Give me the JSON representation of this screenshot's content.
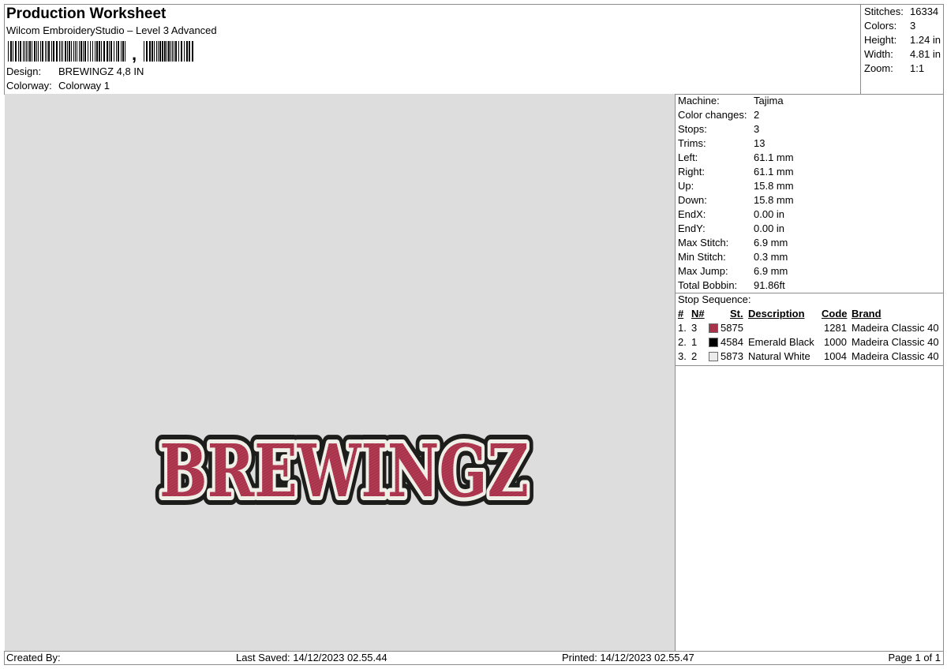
{
  "header": {
    "title": "Production Worksheet",
    "subtitle": "Wilcom EmbroideryStudio – Level 3 Advanced",
    "barcode_text": ",",
    "design_label": "Design:",
    "design_value": "BREWINGZ 4,8 IN",
    "colorway_label": "Colorway:",
    "colorway_value": "Colorway 1"
  },
  "stats": [
    {
      "label": "Stitches:",
      "value": "16334"
    },
    {
      "label": "Colors:",
      "value": "3"
    },
    {
      "label": "Height:",
      "value": "1.24 in"
    },
    {
      "label": "Width:",
      "value": "4.81 in"
    },
    {
      "label": "Zoom:",
      "value": "1:1"
    }
  ],
  "preview": {
    "design_text": "BREWINGZ",
    "colors": {
      "fill": "#a8324a",
      "outline_white": "#efefe8",
      "outline_black": "#1d1d1b",
      "background": "#dddddd"
    }
  },
  "machine_info": [
    {
      "label": "Machine:",
      "value": "Tajima"
    },
    {
      "label": "Color changes:",
      "value": "2"
    },
    {
      "label": "Stops:",
      "value": "3"
    },
    {
      "label": "Trims:",
      "value": "13"
    },
    {
      "label": "Left:",
      "value": "61.1 mm"
    },
    {
      "label": "Right:",
      "value": "61.1 mm"
    },
    {
      "label": "Up:",
      "value": "15.8 mm"
    },
    {
      "label": "Down:",
      "value": "15.8 mm"
    },
    {
      "label": "EndX:",
      "value": "0.00 in"
    },
    {
      "label": "EndY:",
      "value": "0.00 in"
    },
    {
      "label": "Max Stitch:",
      "value": "6.9 mm"
    },
    {
      "label": "Min Stitch:",
      "value": "0.3 mm"
    },
    {
      "label": "Max Jump:",
      "value": "6.9 mm"
    },
    {
      "label": "Total Bobbin:",
      "value": "91.86ft"
    }
  ],
  "stop_sequence": {
    "title": "Stop Sequence:",
    "headers": {
      "num": "#",
      "n": "N#",
      "st": "St.",
      "description": "Description",
      "code": "Code",
      "brand": "Brand"
    },
    "rows": [
      {
        "num": "1.",
        "n": "3",
        "swatch": "#a8324a",
        "st": "5875",
        "description": "",
        "code": "1281",
        "brand": "Madeira Classic 40"
      },
      {
        "num": "2.",
        "n": "1",
        "swatch": "#000000",
        "st": "4584",
        "description": "Emerald Black",
        "code": "1000",
        "brand": "Madeira Classic 40"
      },
      {
        "num": "3.",
        "n": "2",
        "swatch": "#ececec",
        "st": "5873",
        "description": "Natural White",
        "code": "1004",
        "brand": "Madeira Classic 40"
      }
    ]
  },
  "footer": {
    "created_by": "Created By:",
    "last_saved": "Last Saved: 14/12/2023 02.55.44",
    "printed": "Printed: 14/12/2023 02.55.47",
    "page": "Page 1 of 1"
  }
}
